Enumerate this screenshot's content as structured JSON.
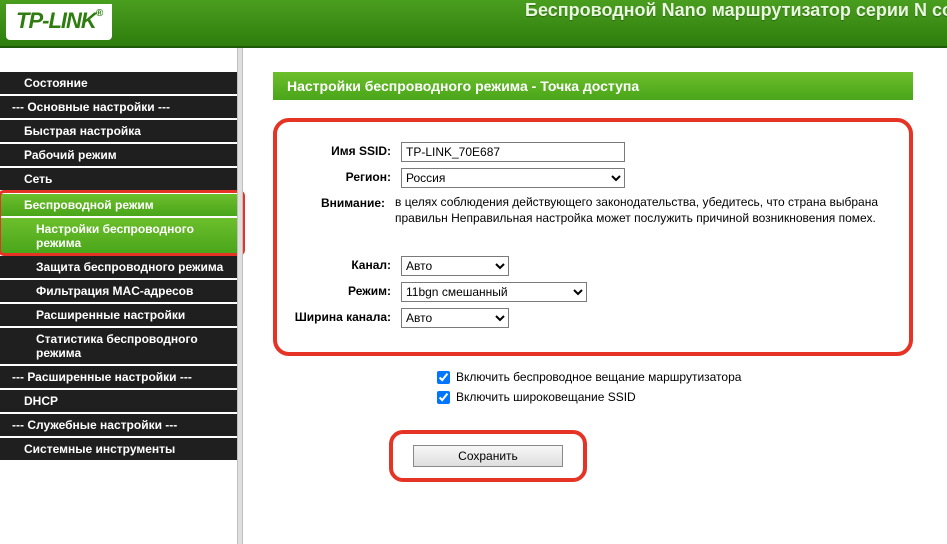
{
  "banner": {
    "logo": "TP-LINK",
    "reg": "®",
    "title": "Беспроводной Nano маршрутизатор серии N со ск"
  },
  "menu": {
    "status": "Состояние",
    "basic_head": "--- Основные настройки ---",
    "quick": "Быстрая настройка",
    "opmode": "Рабочий режим",
    "net": "Сеть",
    "wireless": "Беспроводной режим",
    "wireless_settings": "Настройки беспроводного режима",
    "security": "Защита беспроводного режима",
    "macfilter": "Фильтрация MAC-адресов",
    "advwl": "Расширенные настройки",
    "stats": "Статистика беспроводного режима",
    "adv_head": "--- Расширенные настройки ---",
    "dhcp": "DHCP",
    "svc_head": "--- Служебные настройки ---",
    "systools": "Системные инструменты"
  },
  "page_title": "Настройки беспроводного режима - Точка доступа",
  "labels": {
    "ssid": "Имя SSID:",
    "region": "Регион:",
    "attention": "Внимание:",
    "channel": "Канал:",
    "mode": "Режим:",
    "chwidth": "Ширина канала:"
  },
  "values": {
    "ssid": "TP-LINK_70E687",
    "region": "Россия",
    "channel": "Авто",
    "mode": "11bgn смешанный",
    "chwidth": "Авто"
  },
  "attention_text": "в целях соблюдения действующего законодательства, убедитесь, что страна выбрана правильн Неправильная настройка может послужить причиной возникновения помех.",
  "checks": {
    "broadcast_router": "Включить беспроводное вещание маршрутизатора",
    "broadcast_ssid": "Включить широковещание SSID"
  },
  "save_btn": "Сохранить"
}
